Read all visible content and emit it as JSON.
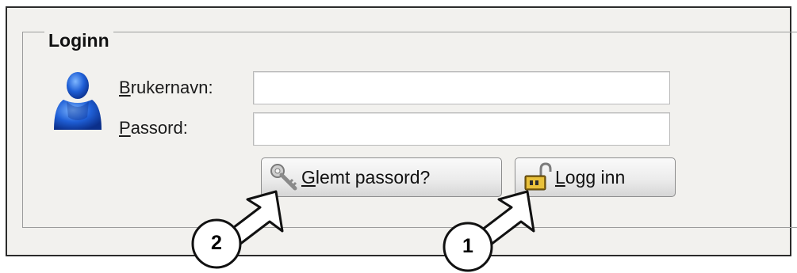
{
  "login": {
    "title": "Loginn",
    "username_label": {
      "underlined": "B",
      "rest": "rukernavn:"
    },
    "password_label": {
      "underlined": "P",
      "rest": "assord:"
    },
    "username_value": "",
    "password_value": ""
  },
  "buttons": {
    "forgot": {
      "underlined": "G",
      "rest": "lemt passord?"
    },
    "login": {
      "underlined": "L",
      "rest": "ogg inn"
    }
  },
  "callouts": [
    {
      "number": "2"
    },
    {
      "number": "1"
    }
  ],
  "icons": {
    "user": "user-icon",
    "key": "key-icon",
    "lock": "unlocked-padlock-icon"
  }
}
